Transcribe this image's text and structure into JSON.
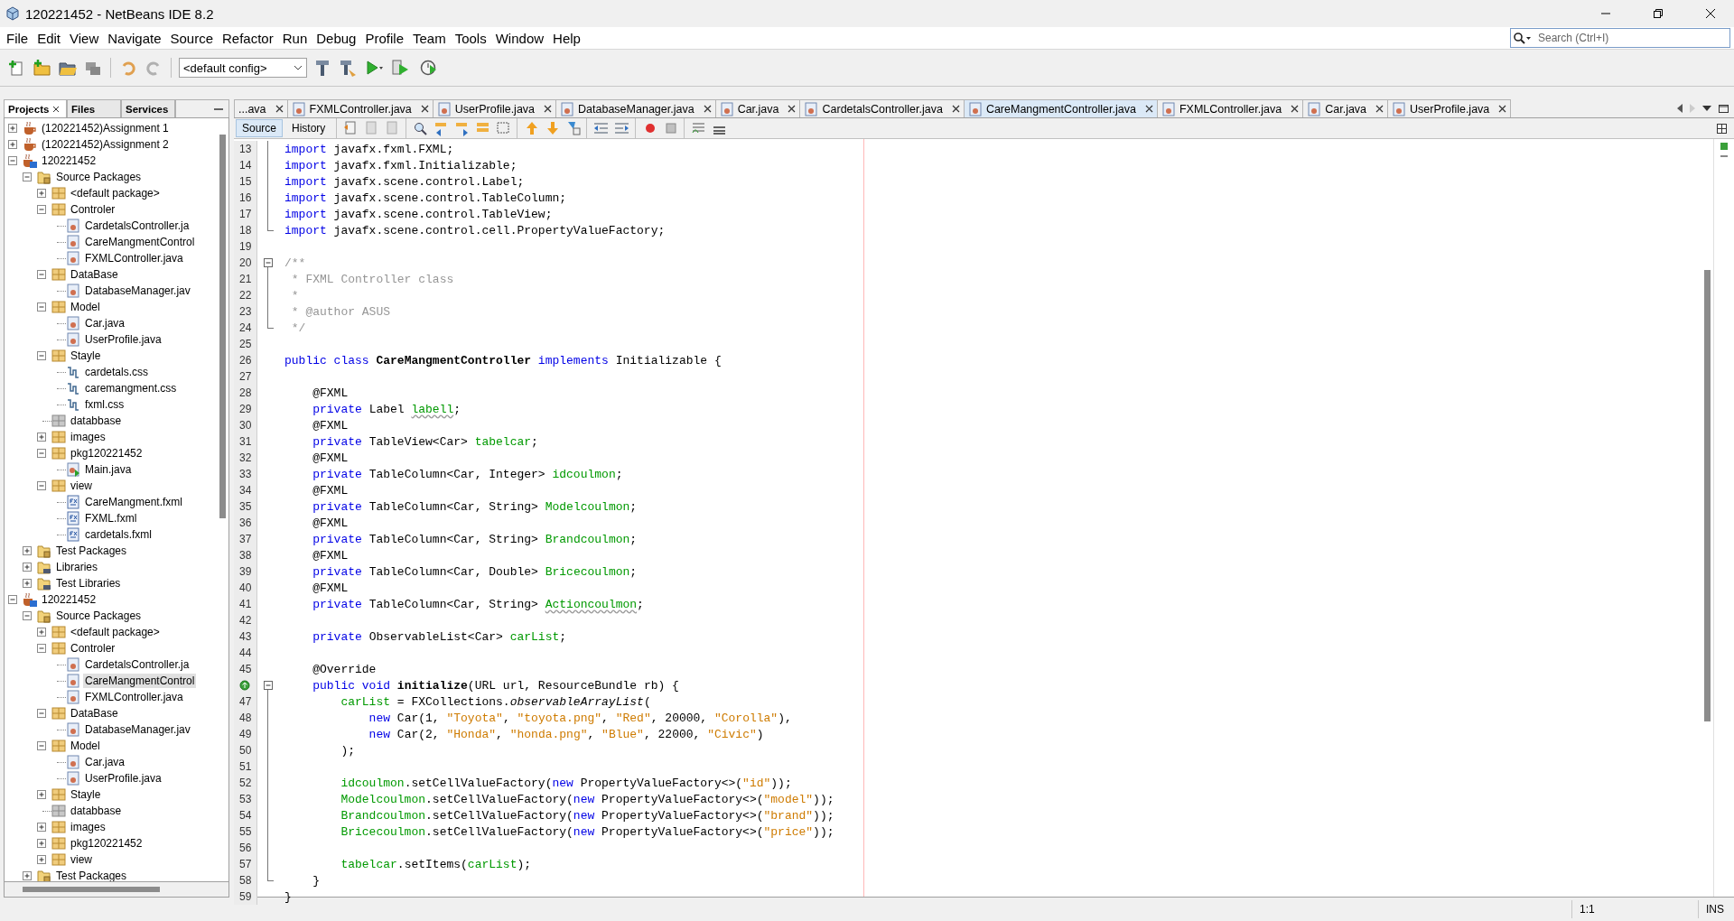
{
  "window": {
    "title": "120221452 - NetBeans IDE 8.2"
  },
  "menu": [
    "File",
    "Edit",
    "View",
    "Navigate",
    "Source",
    "Refactor",
    "Run",
    "Debug",
    "Profile",
    "Team",
    "Tools",
    "Window",
    "Help"
  ],
  "toolbar": {
    "config": "<default config>",
    "search_placeholder": "Search (Ctrl+I)"
  },
  "panel_tabs": [
    {
      "label": "Projects",
      "selected": true
    },
    {
      "label": "Files",
      "selected": false
    },
    {
      "label": "Services",
      "selected": false
    }
  ],
  "tree": [
    {
      "label": "(120221452)Assignment 1",
      "kind": "project",
      "expanded": false,
      "selected": false
    },
    {
      "label": "(120221452)Assignment 2",
      "kind": "project",
      "expanded": false,
      "selected": false
    },
    {
      "label": "120221452",
      "kind": "fxproject",
      "expanded": true,
      "selected": false,
      "children": [
        {
          "label": "Source Packages",
          "kind": "srcfolder",
          "expanded": true,
          "selected": false,
          "children": [
            {
              "label": "<default package>",
              "kind": "package",
              "expanded": false,
              "selected": false
            },
            {
              "label": "Controler",
              "kind": "package",
              "expanded": true,
              "selected": false,
              "children": [
                {
                  "label": "CardetalsController.ja",
                  "kind": "java",
                  "selected": false
                },
                {
                  "label": "CareMangmentControl",
                  "kind": "java",
                  "selected": false
                },
                {
                  "label": "FXMLController.java",
                  "kind": "java",
                  "selected": false
                }
              ]
            },
            {
              "label": "DataBase",
              "kind": "package",
              "expanded": true,
              "selected": false,
              "children": [
                {
                  "label": "DatabaseManager.jav",
                  "kind": "java",
                  "selected": false
                }
              ]
            },
            {
              "label": "Model",
              "kind": "package",
              "expanded": true,
              "selected": false,
              "children": [
                {
                  "label": "Car.java",
                  "kind": "java",
                  "selected": false
                },
                {
                  "label": "UserProfile.java",
                  "kind": "java",
                  "selected": false
                }
              ]
            },
            {
              "label": "Stayle",
              "kind": "package",
              "expanded": true,
              "selected": false,
              "children": [
                {
                  "label": "cardetals.css",
                  "kind": "css",
                  "selected": false
                },
                {
                  "label": "caremangment.css",
                  "kind": "css",
                  "selected": false
                },
                {
                  "label": "fxml.css",
                  "kind": "css",
                  "selected": false
                }
              ]
            },
            {
              "label": "databbase",
              "kind": "emptypackage",
              "selected": false
            },
            {
              "label": "images",
              "kind": "package",
              "expanded": false,
              "selected": false
            },
            {
              "label": "pkg120221452",
              "kind": "package",
              "expanded": true,
              "selected": false,
              "children": [
                {
                  "label": "Main.java",
                  "kind": "main",
                  "selected": false
                }
              ]
            },
            {
              "label": "view",
              "kind": "package",
              "expanded": true,
              "selected": false,
              "children": [
                {
                  "label": "CareMangment.fxml",
                  "kind": "fxml",
                  "selected": false
                },
                {
                  "label": "FXML.fxml",
                  "kind": "fxml",
                  "selected": false
                },
                {
                  "label": "cardetals.fxml",
                  "kind": "fxml",
                  "selected": false
                }
              ]
            }
          ]
        },
        {
          "label": "Test Packages",
          "kind": "srcfolder",
          "expanded": false,
          "selected": false
        },
        {
          "label": "Libraries",
          "kind": "libfolder",
          "expanded": false,
          "selected": false
        },
        {
          "label": "Test Libraries",
          "kind": "libfolder",
          "expanded": false,
          "selected": false
        }
      ]
    },
    {
      "label": "120221452",
      "kind": "fxproject",
      "expanded": true,
      "selected": false,
      "children": [
        {
          "label": "Source Packages",
          "kind": "srcfolder",
          "expanded": true,
          "selected": false,
          "children": [
            {
              "label": "<default package>",
              "kind": "package",
              "expanded": false,
              "selected": false
            },
            {
              "label": "Controler",
              "kind": "package",
              "expanded": true,
              "selected": false,
              "children": [
                {
                  "label": "CardetalsController.ja",
                  "kind": "java",
                  "selected": false
                },
                {
                  "label": "CareMangmentControl",
                  "kind": "java",
                  "selected": true
                },
                {
                  "label": "FXMLController.java",
                  "kind": "java",
                  "selected": false
                }
              ]
            },
            {
              "label": "DataBase",
              "kind": "package",
              "expanded": true,
              "selected": false,
              "children": [
                {
                  "label": "DatabaseManager.jav",
                  "kind": "java",
                  "selected": false
                }
              ]
            },
            {
              "label": "Model",
              "kind": "package",
              "expanded": true,
              "selected": false,
              "children": [
                {
                  "label": "Car.java",
                  "kind": "java",
                  "selected": false
                },
                {
                  "label": "UserProfile.java",
                  "kind": "java",
                  "selected": false
                }
              ]
            },
            {
              "label": "Stayle",
              "kind": "package",
              "expanded": false,
              "selected": false
            },
            {
              "label": "databbase",
              "kind": "emptypackage",
              "selected": false
            },
            {
              "label": "images",
              "kind": "package",
              "expanded": false,
              "selected": false
            },
            {
              "label": "pkg120221452",
              "kind": "package",
              "expanded": false,
              "selected": false
            },
            {
              "label": "view",
              "kind": "package",
              "expanded": false,
              "selected": false
            }
          ]
        },
        {
          "label": "Test Packages",
          "kind": "srcfolder",
          "expanded": false,
          "selected": false
        }
      ]
    }
  ],
  "editor_tabs": [
    {
      "label": "...ava",
      "icon": false,
      "selected": false
    },
    {
      "label": "FXMLController.java",
      "icon": true,
      "selected": false
    },
    {
      "label": "UserProfile.java",
      "icon": true,
      "selected": false
    },
    {
      "label": "DatabaseManager.java",
      "icon": true,
      "selected": false
    },
    {
      "label": "Car.java",
      "icon": true,
      "selected": false
    },
    {
      "label": "CardetalsController.java",
      "icon": true,
      "selected": false
    },
    {
      "label": "CareMangmentController.java",
      "icon": true,
      "selected": true
    },
    {
      "label": "FXMLController.java",
      "icon": true,
      "selected": false
    },
    {
      "label": "Car.java",
      "icon": true,
      "selected": false
    },
    {
      "label": "UserProfile.java",
      "icon": true,
      "selected": false
    }
  ],
  "view_toggle": [
    {
      "label": "Source",
      "selected": true
    },
    {
      "label": "History",
      "selected": false
    }
  ],
  "code": [
    {
      "n": "13",
      "kind": "foldbody",
      "tokens": [
        {
          "kind": "kw",
          "text": "import"
        },
        {
          "kind": "p",
          "text": " javafx.fxml.FXML;"
        }
      ]
    },
    {
      "n": "14",
      "kind": "foldbody",
      "tokens": [
        {
          "kind": "kw",
          "text": "import"
        },
        {
          "kind": "p",
          "text": " javafx.fxml.Initializable;"
        }
      ]
    },
    {
      "n": "15",
      "kind": "foldbody",
      "tokens": [
        {
          "kind": "kw",
          "text": "import"
        },
        {
          "kind": "p",
          "text": " javafx.scene.control.Label;"
        }
      ]
    },
    {
      "n": "16",
      "kind": "foldbody",
      "tokens": [
        {
          "kind": "kw",
          "text": "import"
        },
        {
          "kind": "p",
          "text": " javafx.scene.control.TableColumn;"
        }
      ]
    },
    {
      "n": "17",
      "kind": "foldbody",
      "tokens": [
        {
          "kind": "kw",
          "text": "import"
        },
        {
          "kind": "p",
          "text": " javafx.scene.control.TableView;"
        }
      ]
    },
    {
      "n": "18",
      "kind": "foldend",
      "tokens": [
        {
          "kind": "kw",
          "text": "import"
        },
        {
          "kind": "p",
          "text": " javafx.scene.control.cell.PropertyValueFactory;"
        }
      ]
    },
    {
      "n": "19",
      "kind": "plain"
    },
    {
      "n": "20",
      "kind": "foldstart",
      "tokens": [
        {
          "kind": "cm",
          "text": "/**"
        }
      ]
    },
    {
      "n": "21",
      "kind": "foldbody",
      "tokens": [
        {
          "kind": "cm",
          "text": " * FXML Controller class"
        }
      ]
    },
    {
      "n": "22",
      "kind": "foldbody",
      "tokens": [
        {
          "kind": "cm",
          "text": " *"
        }
      ]
    },
    {
      "n": "23",
      "kind": "foldbody",
      "tokens": [
        {
          "kind": "cm",
          "text": " * @author ASUS"
        }
      ]
    },
    {
      "n": "24",
      "kind": "foldend",
      "tokens": [
        {
          "kind": "cm",
          "text": " */"
        }
      ]
    },
    {
      "n": "25",
      "kind": "plain"
    },
    {
      "n": "26",
      "kind": "plain",
      "tokens": [
        {
          "kind": "kw",
          "text": "public class "
        },
        {
          "kind": "b",
          "text": "CareMangmentController"
        },
        {
          "kind": "kw",
          "text": " implements"
        },
        {
          "kind": "p",
          "text": " Initializable {"
        }
      ]
    },
    {
      "n": "27",
      "kind": "plain"
    },
    {
      "n": "28",
      "kind": "plain",
      "tokens": [
        {
          "kind": "p",
          "text": "    @FXML"
        }
      ]
    },
    {
      "n": "29",
      "kind": "plain",
      "tokens": [
        {
          "kind": "kw",
          "text": "    private"
        },
        {
          "kind": "p",
          "text": " Label "
        },
        {
          "kind": "warn",
          "text": "labell"
        },
        {
          "kind": "p",
          "text": ";"
        }
      ]
    },
    {
      "n": "30",
      "kind": "plain",
      "tokens": [
        {
          "kind": "p",
          "text": "    @FXML"
        }
      ]
    },
    {
      "n": "31",
      "kind": "plain",
      "tokens": [
        {
          "kind": "kw",
          "text": "    private"
        },
        {
          "kind": "p",
          "text": " TableView<Car> "
        },
        {
          "kind": "f",
          "text": "tabelcar"
        },
        {
          "kind": "p",
          "text": ";"
        }
      ]
    },
    {
      "n": "32",
      "kind": "plain",
      "tokens": [
        {
          "kind": "p",
          "text": "    @FXML"
        }
      ]
    },
    {
      "n": "33",
      "kind": "plain",
      "tokens": [
        {
          "kind": "kw",
          "text": "    private"
        },
        {
          "kind": "p",
          "text": " TableColumn<Car, Integer> "
        },
        {
          "kind": "f",
          "text": "idcoulmon"
        },
        {
          "kind": "p",
          "text": ";"
        }
      ]
    },
    {
      "n": "34",
      "kind": "plain",
      "tokens": [
        {
          "kind": "p",
          "text": "    @FXML"
        }
      ]
    },
    {
      "n": "35",
      "kind": "plain",
      "tokens": [
        {
          "kind": "kw",
          "text": "    private"
        },
        {
          "kind": "p",
          "text": " TableColumn<Car, String> "
        },
        {
          "kind": "f",
          "text": "Modelcoulmon"
        },
        {
          "kind": "p",
          "text": ";"
        }
      ]
    },
    {
      "n": "36",
      "kind": "plain",
      "tokens": [
        {
          "kind": "p",
          "text": "    @FXML"
        }
      ]
    },
    {
      "n": "37",
      "kind": "plain",
      "tokens": [
        {
          "kind": "kw",
          "text": "    private"
        },
        {
          "kind": "p",
          "text": " TableColumn<Car, String> "
        },
        {
          "kind": "f",
          "text": "Brandcoulmon"
        },
        {
          "kind": "p",
          "text": ";"
        }
      ]
    },
    {
      "n": "38",
      "kind": "plain",
      "tokens": [
        {
          "kind": "p",
          "text": "    @FXML"
        }
      ]
    },
    {
      "n": "39",
      "kind": "plain",
      "tokens": [
        {
          "kind": "kw",
          "text": "    private"
        },
        {
          "kind": "p",
          "text": " TableColumn<Car, Double> "
        },
        {
          "kind": "f",
          "text": "Bricecoulmon"
        },
        {
          "kind": "p",
          "text": ";"
        }
      ]
    },
    {
      "n": "40",
      "kind": "plain",
      "tokens": [
        {
          "kind": "p",
          "text": "    @FXML"
        }
      ]
    },
    {
      "n": "41",
      "kind": "plain",
      "tokens": [
        {
          "kind": "kw",
          "text": "    private"
        },
        {
          "kind": "p",
          "text": " TableColumn<Car, String> "
        },
        {
          "kind": "warn",
          "text": "Actioncoulmon"
        },
        {
          "kind": "p",
          "text": ";"
        }
      ]
    },
    {
      "n": "42",
      "kind": "plain"
    },
    {
      "n": "43",
      "kind": "plain",
      "tokens": [
        {
          "kind": "kw",
          "text": "    private"
        },
        {
          "kind": "p",
          "text": " ObservableList<Car> "
        },
        {
          "kind": "f",
          "text": "carList"
        },
        {
          "kind": "p",
          "text": ";"
        }
      ]
    },
    {
      "n": "44",
      "kind": "plain"
    },
    {
      "n": "45",
      "kind": "plain",
      "tokens": [
        {
          "kind": "p",
          "text": "    @Override"
        }
      ]
    },
    {
      "kind": "foldstart",
      "override": true,
      "tokens": [
        {
          "kind": "kw",
          "text": "    public void "
        },
        {
          "kind": "b",
          "text": "initialize"
        },
        {
          "kind": "p",
          "text": "(URL url, ResourceBundle rb) {"
        }
      ]
    },
    {
      "n": "47",
      "kind": "foldbody",
      "tokens": [
        {
          "kind": "f",
          "text": "        carList"
        },
        {
          "kind": "p",
          "text": " = FXCollections."
        },
        {
          "kind": "it",
          "text": "observableArrayList"
        },
        {
          "kind": "p",
          "text": "("
        }
      ]
    },
    {
      "n": "48",
      "kind": "foldbody",
      "tokens": [
        {
          "kind": "kw",
          "text": "            new"
        },
        {
          "kind": "p",
          "text": " Car(1, "
        },
        {
          "kind": "s",
          "text": "\"Toyota\""
        },
        {
          "kind": "p",
          "text": ", "
        },
        {
          "kind": "s",
          "text": "\"toyota.png\""
        },
        {
          "kind": "p",
          "text": ", "
        },
        {
          "kind": "s",
          "text": "\"Red\""
        },
        {
          "kind": "p",
          "text": ", 20000, "
        },
        {
          "kind": "s",
          "text": "\"Corolla\""
        },
        {
          "kind": "p",
          "text": "),"
        }
      ]
    },
    {
      "n": "49",
      "kind": "foldbody",
      "tokens": [
        {
          "kind": "kw",
          "text": "            new"
        },
        {
          "kind": "p",
          "text": " Car(2, "
        },
        {
          "kind": "s",
          "text": "\"Honda\""
        },
        {
          "kind": "p",
          "text": ", "
        },
        {
          "kind": "s",
          "text": "\"honda.png\""
        },
        {
          "kind": "p",
          "text": ", "
        },
        {
          "kind": "s",
          "text": "\"Blue\""
        },
        {
          "kind": "p",
          "text": ", 22000, "
        },
        {
          "kind": "s",
          "text": "\"Civic\""
        },
        {
          "kind": "p",
          "text": ")"
        }
      ]
    },
    {
      "n": "50",
      "kind": "foldbody",
      "tokens": [
        {
          "kind": "p",
          "text": "        );"
        }
      ]
    },
    {
      "n": "51",
      "kind": "foldbody"
    },
    {
      "n": "52",
      "kind": "foldbody",
      "tokens": [
        {
          "kind": "f",
          "text": "        idcoulmon"
        },
        {
          "kind": "p",
          "text": ".setCellValueFactory("
        },
        {
          "kind": "kw",
          "text": "new"
        },
        {
          "kind": "p",
          "text": " PropertyValueFactory<>("
        },
        {
          "kind": "s",
          "text": "\"id\""
        },
        {
          "kind": "p",
          "text": "));"
        }
      ]
    },
    {
      "n": "53",
      "kind": "foldbody",
      "tokens": [
        {
          "kind": "f",
          "text": "        Modelcoulmon"
        },
        {
          "kind": "p",
          "text": ".setCellValueFactory("
        },
        {
          "kind": "kw",
          "text": "new"
        },
        {
          "kind": "p",
          "text": " PropertyValueFactory<>("
        },
        {
          "kind": "s",
          "text": "\"model\""
        },
        {
          "kind": "p",
          "text": "));"
        }
      ]
    },
    {
      "n": "54",
      "kind": "foldbody",
      "tokens": [
        {
          "kind": "f",
          "text": "        Brandcoulmon"
        },
        {
          "kind": "p",
          "text": ".setCellValueFactory("
        },
        {
          "kind": "kw",
          "text": "new"
        },
        {
          "kind": "p",
          "text": " PropertyValueFactory<>("
        },
        {
          "kind": "s",
          "text": "\"brand\""
        },
        {
          "kind": "p",
          "text": "));"
        }
      ]
    },
    {
      "n": "55",
      "kind": "foldbody",
      "tokens": [
        {
          "kind": "f",
          "text": "        Bricecoulmon"
        },
        {
          "kind": "p",
          "text": ".setCellValueFactory("
        },
        {
          "kind": "kw",
          "text": "new"
        },
        {
          "kind": "p",
          "text": " PropertyValueFactory<>("
        },
        {
          "kind": "s",
          "text": "\"price\""
        },
        {
          "kind": "p",
          "text": "));"
        }
      ]
    },
    {
      "n": "56",
      "kind": "foldbody"
    },
    {
      "n": "57",
      "kind": "foldbody",
      "tokens": [
        {
          "kind": "f",
          "text": "        tabelcar"
        },
        {
          "kind": "p",
          "text": ".setItems("
        },
        {
          "kind": "f",
          "text": "carList"
        },
        {
          "kind": "p",
          "text": ");"
        }
      ]
    },
    {
      "n": "58",
      "kind": "foldend",
      "tokens": [
        {
          "kind": "p",
          "text": "    }"
        }
      ]
    },
    {
      "n": "59",
      "kind": "plain",
      "tokens": [
        {
          "kind": "p",
          "text": "}"
        }
      ]
    }
  ],
  "status_bar": {
    "position": "1:1",
    "mode": "INS"
  }
}
